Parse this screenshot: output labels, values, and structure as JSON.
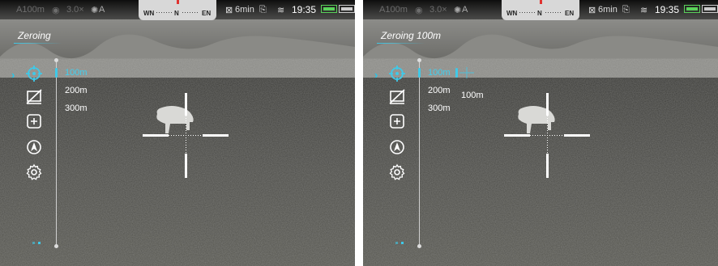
{
  "status_bar": {
    "range": "A100m",
    "zoom": "3.0×",
    "mode": "A",
    "compass_left": "WN",
    "compass_center": "N",
    "compass_right": "EN",
    "recording_time": "6min",
    "time": "19:35"
  },
  "screens": [
    {
      "title": "Zeroing",
      "distances": [
        "100m",
        "200m",
        "300m"
      ],
      "selected_distance": "100m"
    },
    {
      "title": "Zeroing 100m",
      "distances": [
        "100m",
        "200m",
        "300m"
      ],
      "selected_distance": "100m",
      "zero_distance_label": "100m"
    }
  ],
  "menu_icons": [
    "target-crosshair-icon",
    "display-off-icon",
    "add-icon",
    "navigation-icon",
    "gear-icon"
  ],
  "colors": {
    "accent": "#3fc9e8",
    "battery": "#5ad15a",
    "compass_marker": "#e0322f"
  }
}
